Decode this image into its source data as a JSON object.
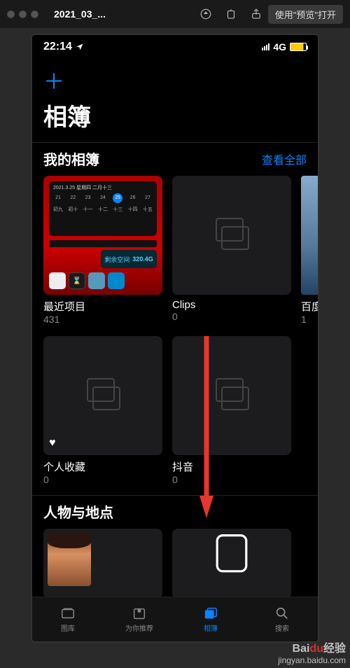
{
  "chrome": {
    "title": "2021_03_...",
    "open_with": "使用\"预览\"打开"
  },
  "status": {
    "time": "22:14",
    "network": "4G"
  },
  "header": {
    "add_label": "＋",
    "page_title": "相簿"
  },
  "sections": {
    "my_albums": {
      "title": "我的相簿",
      "see_all": "查看全部",
      "albums": [
        {
          "label": "最近项目",
          "count": "431",
          "disk_label": "剩余空间",
          "disk_value": "320.4G",
          "cal_date": "2021.3.25 星期四 二月十三"
        },
        {
          "label": "Clips",
          "count": "0"
        },
        {
          "label": "百度",
          "count": "1"
        },
        {
          "label": "个人收藏",
          "count": "0"
        },
        {
          "label": "抖音",
          "count": "0"
        }
      ]
    },
    "people_places": {
      "title": "人物与地点"
    }
  },
  "tabs": [
    {
      "label": "图库"
    },
    {
      "label": "为你推荐"
    },
    {
      "label": "相簿"
    },
    {
      "label": "搜索"
    }
  ],
  "watermark": {
    "brand_pre": "Bai",
    "brand_du": "du",
    "brand_post": "经验",
    "url": "jingyan.baidu.com"
  }
}
